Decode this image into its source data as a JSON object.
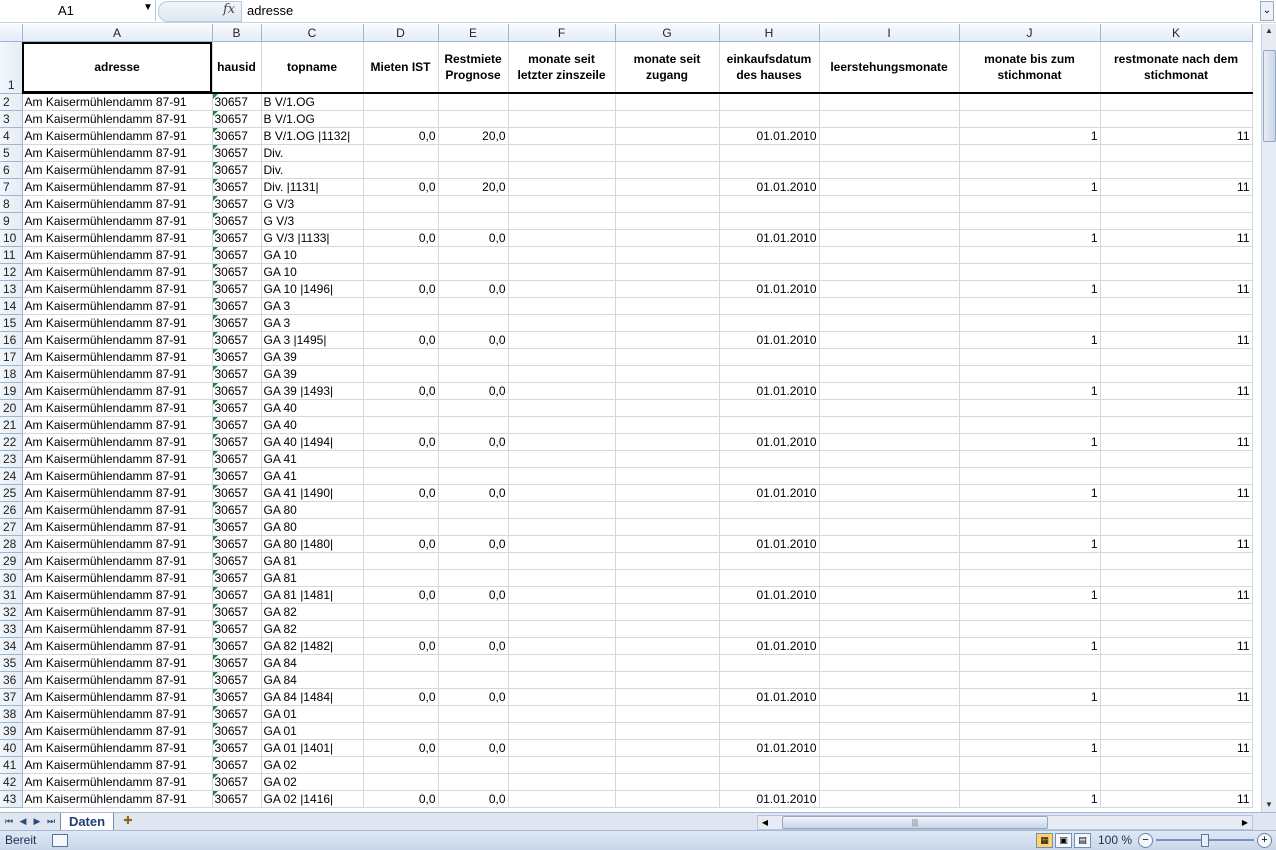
{
  "formula_bar": {
    "name_box": "A1",
    "fx_label": "fx",
    "content": "adresse"
  },
  "columns": [
    "",
    "A",
    "B",
    "C",
    "D",
    "E",
    "F",
    "G",
    "H",
    "I",
    "J",
    "K"
  ],
  "headers": {
    "row_number": "1",
    "cells": [
      "adresse",
      "hausid",
      "topname",
      "Mieten IST",
      "Restmiete Prognose",
      "monate seit letzter zinszeile",
      "monate seit zugang",
      "einkaufsdatum des hauses",
      "leerstehungsmonate",
      "monate bis zum stichmonat",
      "restmonate nach dem stichmonat"
    ],
    "overflow_hint": "s"
  },
  "rows": [
    [
      "2",
      "Am Kaisermühlendamm 87-91",
      "30657",
      "B V/1.OG",
      "",
      "",
      "",
      "",
      "",
      "",
      "",
      ""
    ],
    [
      "3",
      "Am Kaisermühlendamm 87-91",
      "30657",
      "B V/1.OG",
      "",
      "",
      "",
      "",
      "",
      "",
      "",
      ""
    ],
    [
      "4",
      "Am Kaisermühlendamm 87-91",
      "30657",
      "B V/1.OG |1132|",
      "0,0",
      "20,0",
      "",
      "",
      "01.01.2010",
      "",
      "1",
      "11"
    ],
    [
      "5",
      "Am Kaisermühlendamm 87-91",
      "30657",
      "Div.",
      "",
      "",
      "",
      "",
      "",
      "",
      "",
      ""
    ],
    [
      "6",
      "Am Kaisermühlendamm 87-91",
      "30657",
      "Div.",
      "",
      "",
      "",
      "",
      "",
      "",
      "",
      ""
    ],
    [
      "7",
      "Am Kaisermühlendamm 87-91",
      "30657",
      "Div. |1131|",
      "0,0",
      "20,0",
      "",
      "",
      "01.01.2010",
      "",
      "1",
      "11"
    ],
    [
      "8",
      "Am Kaisermühlendamm 87-91",
      "30657",
      "G V/3",
      "",
      "",
      "",
      "",
      "",
      "",
      "",
      ""
    ],
    [
      "9",
      "Am Kaisermühlendamm 87-91",
      "30657",
      "G V/3",
      "",
      "",
      "",
      "",
      "",
      "",
      "",
      ""
    ],
    [
      "10",
      "Am Kaisermühlendamm 87-91",
      "30657",
      "G V/3 |1133|",
      "0,0",
      "0,0",
      "",
      "",
      "01.01.2010",
      "",
      "1",
      "11"
    ],
    [
      "11",
      "Am Kaisermühlendamm 87-91",
      "30657",
      "GA  10",
      "",
      "",
      "",
      "",
      "",
      "",
      "",
      ""
    ],
    [
      "12",
      "Am Kaisermühlendamm 87-91",
      "30657",
      "GA  10",
      "",
      "",
      "",
      "",
      "",
      "",
      "",
      ""
    ],
    [
      "13",
      "Am Kaisermühlendamm 87-91",
      "30657",
      "GA  10 |1496|",
      "0,0",
      "0,0",
      "",
      "",
      "01.01.2010",
      "",
      "1",
      "11"
    ],
    [
      "14",
      "Am Kaisermühlendamm 87-91",
      "30657",
      "GA  3",
      "",
      "",
      "",
      "",
      "",
      "",
      "",
      ""
    ],
    [
      "15",
      "Am Kaisermühlendamm 87-91",
      "30657",
      "GA  3",
      "",
      "",
      "",
      "",
      "",
      "",
      "",
      ""
    ],
    [
      "16",
      "Am Kaisermühlendamm 87-91",
      "30657",
      "GA  3 |1495|",
      "0,0",
      "0,0",
      "",
      "",
      "01.01.2010",
      "",
      "1",
      "11"
    ],
    [
      "17",
      "Am Kaisermühlendamm 87-91",
      "30657",
      "GA  39",
      "",
      "",
      "",
      "",
      "",
      "",
      "",
      ""
    ],
    [
      "18",
      "Am Kaisermühlendamm 87-91",
      "30657",
      "GA  39",
      "",
      "",
      "",
      "",
      "",
      "",
      "",
      ""
    ],
    [
      "19",
      "Am Kaisermühlendamm 87-91",
      "30657",
      "GA  39 |1493|",
      "0,0",
      "0,0",
      "",
      "",
      "01.01.2010",
      "",
      "1",
      "11"
    ],
    [
      "20",
      "Am Kaisermühlendamm 87-91",
      "30657",
      "GA  40",
      "",
      "",
      "",
      "",
      "",
      "",
      "",
      ""
    ],
    [
      "21",
      "Am Kaisermühlendamm 87-91",
      "30657",
      "GA  40",
      "",
      "",
      "",
      "",
      "",
      "",
      "",
      ""
    ],
    [
      "22",
      "Am Kaisermühlendamm 87-91",
      "30657",
      "GA  40 |1494|",
      "0,0",
      "0,0",
      "",
      "",
      "01.01.2010",
      "",
      "1",
      "11"
    ],
    [
      "23",
      "Am Kaisermühlendamm 87-91",
      "30657",
      "GA  41",
      "",
      "",
      "",
      "",
      "",
      "",
      "",
      ""
    ],
    [
      "24",
      "Am Kaisermühlendamm 87-91",
      "30657",
      "GA  41",
      "",
      "",
      "",
      "",
      "",
      "",
      "",
      ""
    ],
    [
      "25",
      "Am Kaisermühlendamm 87-91",
      "30657",
      "GA  41 |1490|",
      "0,0",
      "0,0",
      "",
      "",
      "01.01.2010",
      "",
      "1",
      "11"
    ],
    [
      "26",
      "Am Kaisermühlendamm 87-91",
      "30657",
      "GA  80",
      "",
      "",
      "",
      "",
      "",
      "",
      "",
      ""
    ],
    [
      "27",
      "Am Kaisermühlendamm 87-91",
      "30657",
      "GA  80",
      "",
      "",
      "",
      "",
      "",
      "",
      "",
      ""
    ],
    [
      "28",
      "Am Kaisermühlendamm 87-91",
      "30657",
      "GA  80 |1480|",
      "0,0",
      "0,0",
      "",
      "",
      "01.01.2010",
      "",
      "1",
      "11"
    ],
    [
      "29",
      "Am Kaisermühlendamm 87-91",
      "30657",
      "GA  81",
      "",
      "",
      "",
      "",
      "",
      "",
      "",
      ""
    ],
    [
      "30",
      "Am Kaisermühlendamm 87-91",
      "30657",
      "GA  81",
      "",
      "",
      "",
      "",
      "",
      "",
      "",
      ""
    ],
    [
      "31",
      "Am Kaisermühlendamm 87-91",
      "30657",
      "GA  81 |1481|",
      "0,0",
      "0,0",
      "",
      "",
      "01.01.2010",
      "",
      "1",
      "11"
    ],
    [
      "32",
      "Am Kaisermühlendamm 87-91",
      "30657",
      "GA  82",
      "",
      "",
      "",
      "",
      "",
      "",
      "",
      ""
    ],
    [
      "33",
      "Am Kaisermühlendamm 87-91",
      "30657",
      "GA  82",
      "",
      "",
      "",
      "",
      "",
      "",
      "",
      ""
    ],
    [
      "34",
      "Am Kaisermühlendamm 87-91",
      "30657",
      "GA  82 |1482|",
      "0,0",
      "0,0",
      "",
      "",
      "01.01.2010",
      "",
      "1",
      "11"
    ],
    [
      "35",
      "Am Kaisermühlendamm 87-91",
      "30657",
      "GA  84",
      "",
      "",
      "",
      "",
      "",
      "",
      "",
      ""
    ],
    [
      "36",
      "Am Kaisermühlendamm 87-91",
      "30657",
      "GA  84",
      "",
      "",
      "",
      "",
      "",
      "",
      "",
      ""
    ],
    [
      "37",
      "Am Kaisermühlendamm 87-91",
      "30657",
      "GA  84 |1484|",
      "0,0",
      "0,0",
      "",
      "",
      "01.01.2010",
      "",
      "1",
      "11"
    ],
    [
      "38",
      "Am Kaisermühlendamm 87-91",
      "30657",
      "GA 01",
      "",
      "",
      "",
      "",
      "",
      "",
      "",
      ""
    ],
    [
      "39",
      "Am Kaisermühlendamm 87-91",
      "30657",
      "GA 01",
      "",
      "",
      "",
      "",
      "",
      "",
      "",
      ""
    ],
    [
      "40",
      "Am Kaisermühlendamm 87-91",
      "30657",
      "GA 01 |1401|",
      "0,0",
      "0,0",
      "",
      "",
      "01.01.2010",
      "",
      "1",
      "11"
    ],
    [
      "41",
      "Am Kaisermühlendamm 87-91",
      "30657",
      "GA 02",
      "",
      "",
      "",
      "",
      "",
      "",
      "",
      ""
    ],
    [
      "42",
      "Am Kaisermühlendamm 87-91",
      "30657",
      "GA 02",
      "",
      "",
      "",
      "",
      "",
      "",
      "",
      ""
    ],
    [
      "43",
      "Am Kaisermühlendamm 87-91",
      "30657",
      "GA 02 |1416|",
      "0,0",
      "0,0",
      "",
      "",
      "01.01.2010",
      "",
      "1",
      "11"
    ]
  ],
  "sheet_tabs": {
    "active": "Daten"
  },
  "status_bar": {
    "status": "Bereit",
    "zoom": "100 %"
  },
  "icons": {
    "name_box_dropdown": "chevron-down-icon",
    "formula": "fx-icon",
    "nav_first": "first-sheet-icon",
    "nav_prev": "prev-sheet-icon",
    "nav_next": "next-sheet-icon",
    "nav_last": "last-sheet-icon",
    "new_sheet": "insert-sheet-icon",
    "macro": "macro-record-icon"
  },
  "colors": {
    "header_bg": "#e4ecf7",
    "grid_line": "#d0d7e5",
    "error_marker": "#1f8a3c",
    "active_tab_text": "#1f3f73"
  }
}
